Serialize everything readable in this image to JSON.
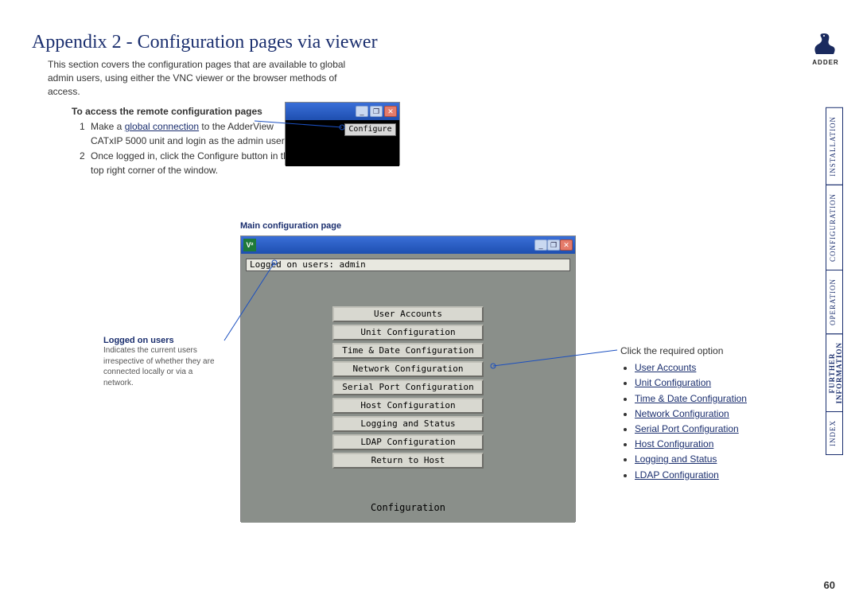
{
  "title": "Appendix 2 - Configuration pages via viewer",
  "intro": "This section covers the configuration pages that are available to global admin users, using either the VNC viewer or the browser methods of access.",
  "access_heading": "To access the remote configuration pages",
  "step1_pre": "Make a ",
  "step1_link": "global connection",
  "step1_post": " to the AdderView CATxIP 5000 unit and login as the admin user.",
  "step2": "Once logged in, click the Configure button in the top right corner of the window.",
  "shot1": {
    "configure": "Configure"
  },
  "caption_main": "Main configuration page",
  "shot2": {
    "logged_text": "Logged on users: admin",
    "buttons": [
      "User Accounts",
      "Unit Configuration",
      "Time & Date Configuration",
      "Network Configuration",
      "Serial Port Configuration",
      "Host Configuration",
      "Logging and Status",
      "LDAP Configuration",
      "Return to Host"
    ],
    "footer": "Configuration"
  },
  "note_logged": {
    "title": "Logged on users",
    "body": "Indicates the current users irrespective of whether they are connected locally or via a network."
  },
  "right": {
    "lead": "Click the required option",
    "items": [
      "User Accounts",
      "Unit Configuration",
      "Time & Date Configuration",
      "Network Configuration",
      "Serial Port Configuration",
      "Host Configuration",
      "Logging and Status",
      "LDAP Configuration"
    ]
  },
  "nav": {
    "installation": "INSTALLATION",
    "configuration": "CONFIGURATION",
    "operation": "OPERATION",
    "further1": "FURTHER",
    "further2": "INFORMATION",
    "index": "INDEX"
  },
  "logo_text": "ADDER",
  "page_number": "60"
}
